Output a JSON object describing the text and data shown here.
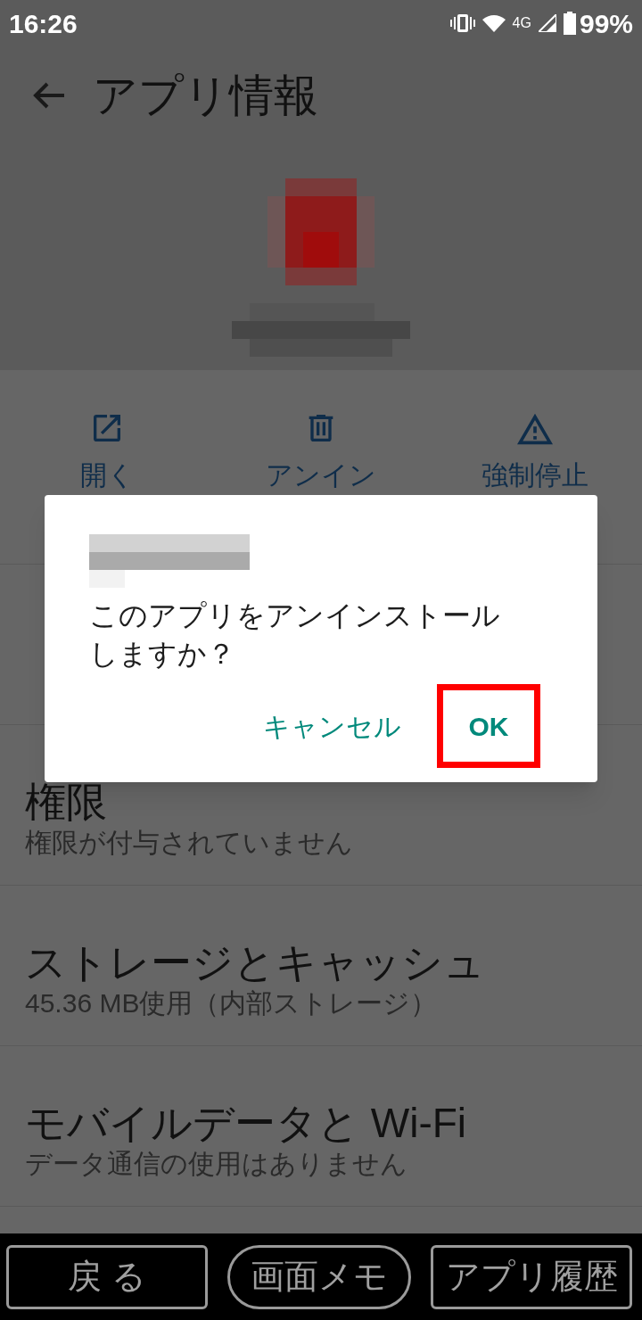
{
  "status_bar": {
    "time": "16:26",
    "network": "4G",
    "battery": "99%"
  },
  "header": {
    "title": "アプリ情報"
  },
  "actions": [
    {
      "label": "開く",
      "kind": "open"
    },
    {
      "label": "アンイン",
      "kind": "delete"
    },
    {
      "label": "強制停止",
      "kind": "stop"
    }
  ],
  "settings": [
    {
      "title": "権限",
      "subtitle": "権限が付与されていません"
    },
    {
      "title": "ストレージとキャッシュ",
      "subtitle": "45.36 MB使用（内部ストレージ）"
    },
    {
      "title": "モバイルデータと Wi-Fi",
      "subtitle": "データ通信の使用はありません"
    }
  ],
  "dialog": {
    "message": "このアプリをアンインストールしますか？",
    "buttons": [
      {
        "label": "キャンセル",
        "highlighted": false
      },
      {
        "label": "OK",
        "highlighted": true
      }
    ]
  },
  "nav_bar": {
    "buttons": [
      {
        "label": "戻 る",
        "kind": "rect"
      },
      {
        "label": "画面メモ",
        "kind": "pill"
      },
      {
        "label": "アプリ履歴",
        "kind": "rect"
      }
    ]
  }
}
